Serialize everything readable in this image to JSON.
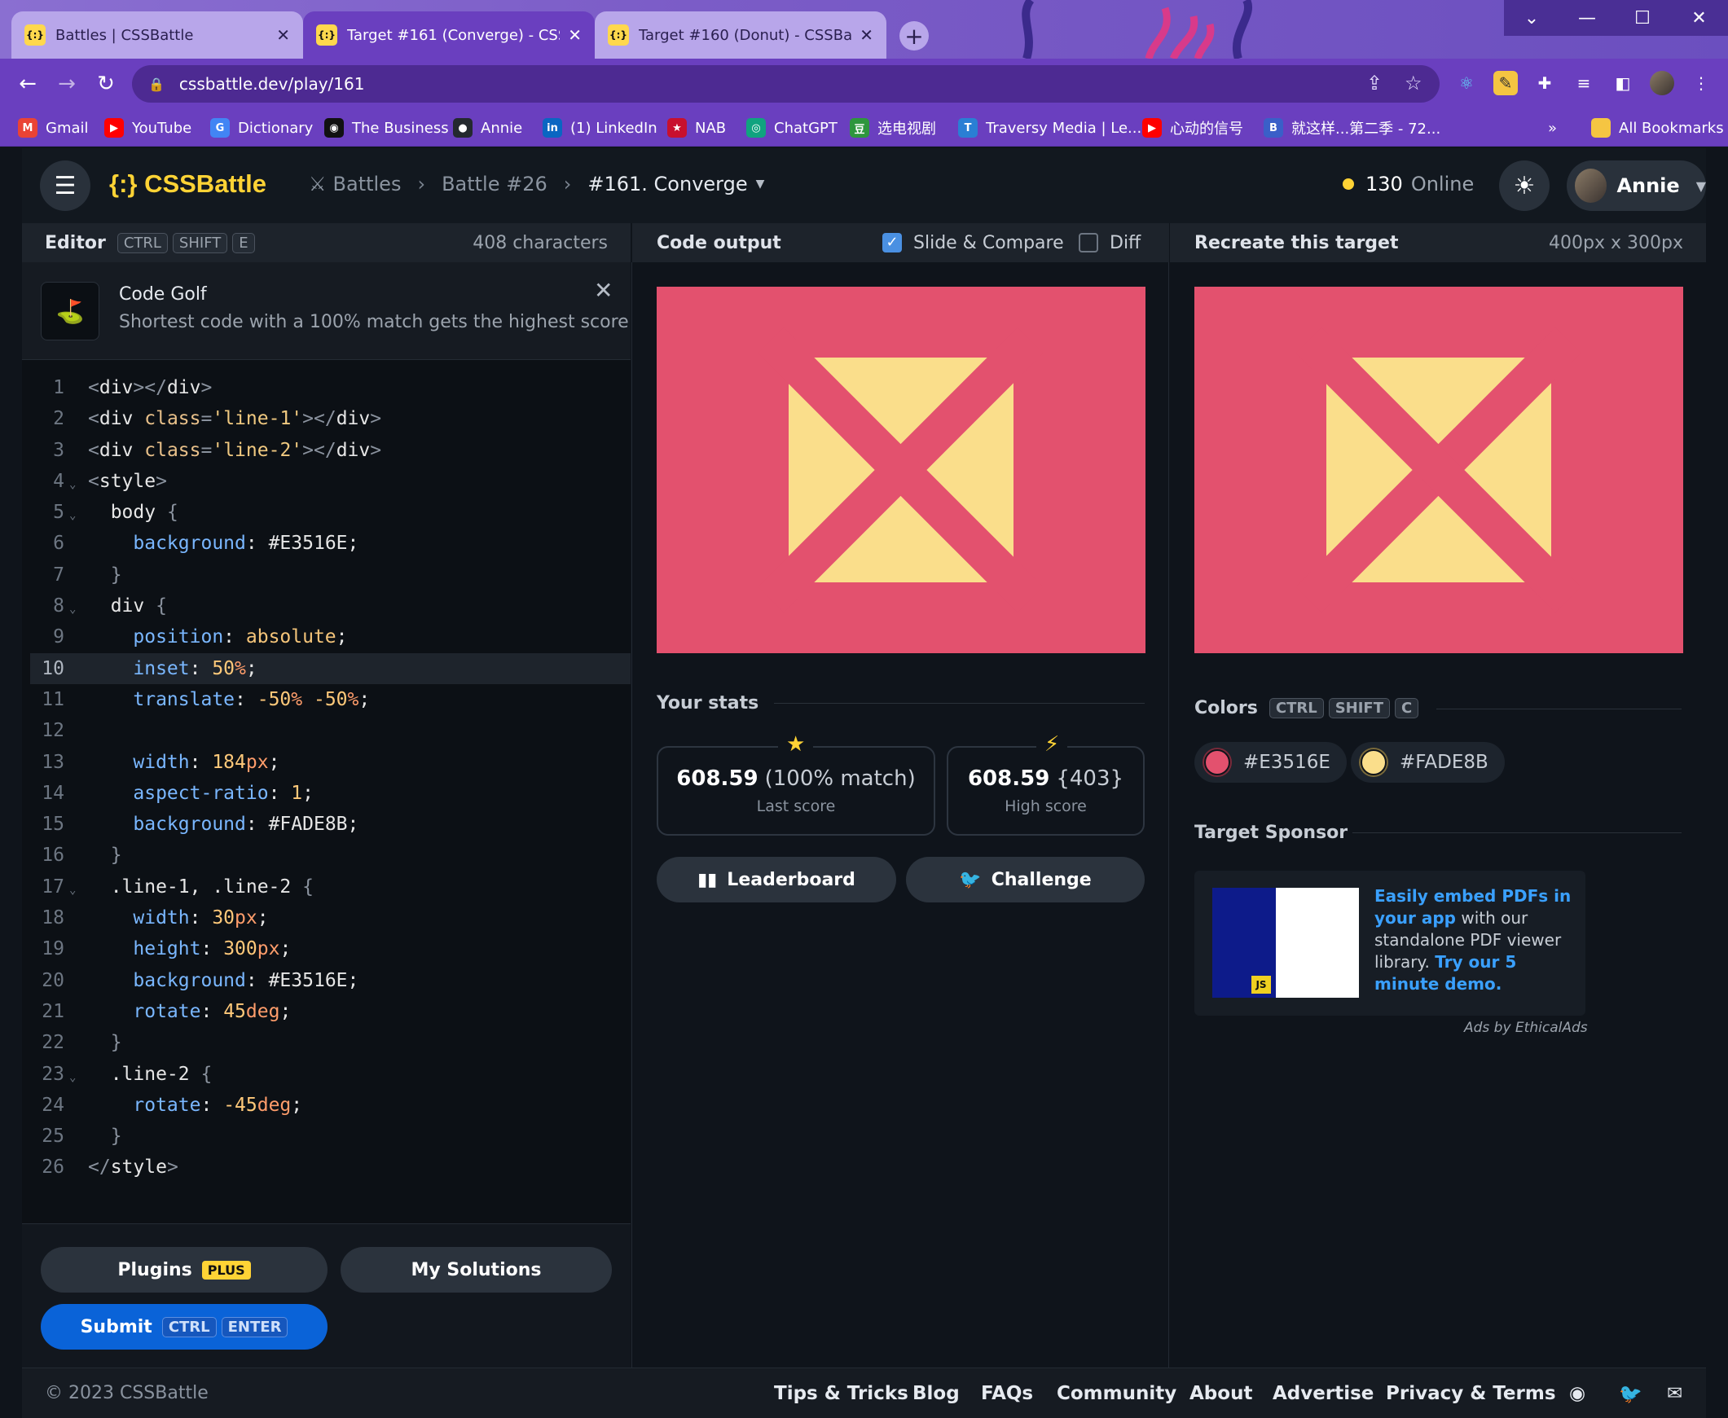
{
  "browser": {
    "tabs": [
      {
        "favicon": "{:}",
        "title": "Battles | CSSBattle",
        "close": "✕"
      },
      {
        "favicon": "{:}",
        "title": "Target #161 (Converge) - CSSBattle",
        "close": "✕"
      },
      {
        "favicon": "{:}",
        "title": "Target #160 (Donut) - CSSBattle",
        "close": "✕"
      }
    ],
    "url": "cssbattle.dev/play/161",
    "bookmarks": [
      {
        "label": "Gmail",
        "icon": "M",
        "color": "#ea4335"
      },
      {
        "label": "YouTube",
        "icon": "▶",
        "color": "#ff0000"
      },
      {
        "label": "Dictionary",
        "icon": "G",
        "color": "#4285f4"
      },
      {
        "label": "The Business",
        "icon": "◉",
        "color": "#111111"
      },
      {
        "label": "Annie",
        "icon": "●",
        "color": "#24292f"
      },
      {
        "label": "(1) LinkedIn",
        "icon": "in",
        "color": "#0a66c2"
      },
      {
        "label": "NAB",
        "icon": "★",
        "color": "#c8102e"
      },
      {
        "label": "ChatGPT",
        "icon": "◎",
        "color": "#10a37f"
      },
      {
        "label": "选电视剧",
        "icon": "豆",
        "color": "#2e963d"
      },
      {
        "label": "Traversy Media | Le...",
        "icon": "T",
        "color": "#2a7fd4"
      },
      {
        "label": "心动的信号",
        "icon": "▶",
        "color": "#ff0000"
      },
      {
        "label": "就这样...第二季 - 72...",
        "icon": "B",
        "color": "#3a5fc8"
      }
    ],
    "more_bookmarks": "»",
    "all_bookmarks": "All Bookmarks"
  },
  "header": {
    "logo": "{:} CSSBattle",
    "breadcrumb": [
      "Battles",
      "Battle #26",
      "#161. Converge"
    ],
    "online_count": "130",
    "online_label": "Online",
    "user": "Annie"
  },
  "editor": {
    "title": "Editor",
    "shortcut": [
      "CTRL",
      "SHIFT",
      "E"
    ],
    "char_count": "408 characters",
    "banner_title": "Code Golf",
    "banner_desc": "Shortest code with a 100% match gets the highest score",
    "highlight_line": 10,
    "lines": [
      [
        [
          "t-ang",
          "<"
        ],
        [
          "t-tag",
          "div"
        ],
        [
          "t-ang",
          "></"
        ],
        [
          "t-tag",
          "div"
        ],
        [
          "t-ang",
          ">"
        ]
      ],
      [
        [
          "t-ang",
          "<"
        ],
        [
          "t-tag",
          "div "
        ],
        [
          "t-attr",
          "class"
        ],
        [
          "t-ang",
          "="
        ],
        [
          "t-str",
          "'line-1'"
        ],
        [
          "t-ang",
          "></"
        ],
        [
          "t-tag",
          "div"
        ],
        [
          "t-ang",
          ">"
        ]
      ],
      [
        [
          "t-ang",
          "<"
        ],
        [
          "t-tag",
          "div "
        ],
        [
          "t-attr",
          "class"
        ],
        [
          "t-ang",
          "="
        ],
        [
          "t-str",
          "'line-2'"
        ],
        [
          "t-ang",
          "></"
        ],
        [
          "t-tag",
          "div"
        ],
        [
          "t-ang",
          ">"
        ]
      ],
      [
        [
          "t-ang",
          "<"
        ],
        [
          "t-tag",
          "style"
        ],
        [
          "t-ang",
          ">"
        ]
      ],
      [
        [
          "t-tag",
          "  body "
        ],
        [
          "t-brace",
          "{"
        ]
      ],
      [
        [
          "t-prop",
          "    background"
        ],
        [
          "t-tag",
          ": "
        ],
        [
          "t-tag",
          "#E3516E;"
        ]
      ],
      [
        [
          "t-brace",
          "  }"
        ]
      ],
      [
        [
          "t-tag",
          "  div "
        ],
        [
          "t-brace",
          "{"
        ]
      ],
      [
        [
          "t-prop",
          "    position"
        ],
        [
          "t-tag",
          ": "
        ],
        [
          "t-kw",
          "absolute"
        ],
        [
          "t-tag",
          ";"
        ]
      ],
      [
        [
          "t-prop",
          "    inset"
        ],
        [
          "t-tag",
          ": "
        ],
        [
          "t-num",
          "50"
        ],
        [
          "t-unit",
          "%"
        ],
        [
          "t-tag",
          ";"
        ]
      ],
      [
        [
          "t-prop",
          "    translate"
        ],
        [
          "t-tag",
          ": "
        ],
        [
          "t-num",
          "-50"
        ],
        [
          "t-unit",
          "% "
        ],
        [
          "t-num",
          "-50"
        ],
        [
          "t-unit",
          "%"
        ],
        [
          "t-tag",
          ";"
        ]
      ],
      [],
      [
        [
          "t-prop",
          "    width"
        ],
        [
          "t-tag",
          ": "
        ],
        [
          "t-num",
          "184"
        ],
        [
          "t-unit",
          "px"
        ],
        [
          "t-tag",
          ";"
        ]
      ],
      [
        [
          "t-prop",
          "    aspect-ratio"
        ],
        [
          "t-tag",
          ": "
        ],
        [
          "t-num",
          "1"
        ],
        [
          "t-tag",
          ";"
        ]
      ],
      [
        [
          "t-prop",
          "    background"
        ],
        [
          "t-tag",
          ": "
        ],
        [
          "t-tag",
          "#FADE8B;"
        ]
      ],
      [
        [
          "t-brace",
          "  }"
        ]
      ],
      [
        [
          "t-tag",
          "  .line-1, .line-2 "
        ],
        [
          "t-brace",
          "{"
        ]
      ],
      [
        [
          "t-prop",
          "    width"
        ],
        [
          "t-tag",
          ": "
        ],
        [
          "t-num",
          "30"
        ],
        [
          "t-unit",
          "px"
        ],
        [
          "t-tag",
          ";"
        ]
      ],
      [
        [
          "t-prop",
          "    height"
        ],
        [
          "t-tag",
          ": "
        ],
        [
          "t-num",
          "300"
        ],
        [
          "t-unit",
          "px"
        ],
        [
          "t-tag",
          ";"
        ]
      ],
      [
        [
          "t-prop",
          "    background"
        ],
        [
          "t-tag",
          ": "
        ],
        [
          "t-tag",
          "#E3516E;"
        ]
      ],
      [
        [
          "t-prop",
          "    rotate"
        ],
        [
          "t-tag",
          ": "
        ],
        [
          "t-num",
          "45"
        ],
        [
          "t-unit",
          "deg"
        ],
        [
          "t-tag",
          ";"
        ]
      ],
      [
        [
          "t-brace",
          "  }"
        ]
      ],
      [
        [
          "t-tag",
          "  .line-2 "
        ],
        [
          "t-brace",
          "{"
        ]
      ],
      [
        [
          "t-prop",
          "    rotate"
        ],
        [
          "t-tag",
          ": "
        ],
        [
          "t-num",
          "-45"
        ],
        [
          "t-unit",
          "deg"
        ],
        [
          "t-tag",
          ";"
        ]
      ],
      [
        [
          "t-brace",
          "  }"
        ]
      ],
      [
        [
          "t-ang",
          "</"
        ],
        [
          "t-tag",
          "style"
        ],
        [
          "t-ang",
          ">"
        ]
      ]
    ],
    "fold_lines": [
      4,
      5,
      8,
      17,
      23
    ],
    "plugins_label": "Plugins",
    "plugins_badge": "PLUS",
    "my_solutions_label": "My Solutions",
    "submit_label": "Submit",
    "submit_shortcut": [
      "CTRL",
      "ENTER"
    ]
  },
  "output": {
    "title": "Code output",
    "slide_compare_label": "Slide & Compare",
    "slide_compare_checked": true,
    "diff_label": "Diff",
    "diff_checked": false,
    "stats_title": "Your stats",
    "last_score": "608.59",
    "last_match": "(100% match)",
    "last_label": "Last score",
    "high_score": "608.59",
    "high_chars": "{403}",
    "high_label": "High score",
    "leaderboard_label": "Leaderboard",
    "challenge_label": "Challenge"
  },
  "target": {
    "title": "Recreate this target",
    "size": "400px x 300px",
    "colors_title": "Colors",
    "colors_shortcut": [
      "CTRL",
      "SHIFT",
      "C"
    ],
    "colors": [
      "#E3516E",
      "#FADE8B"
    ],
    "sponsor_title": "Target Sponsor",
    "ad_link1": "Easily embed PDFs in your app",
    "ad_text1": " with our standalone PDF viewer library. ",
    "ad_link2": "Try our 5 minute demo.",
    "ads_by": "Ads by EthicalAds"
  },
  "footer": {
    "copyright": "© 2023 CSSBattle",
    "links": [
      "Tips & Tricks",
      "Blog",
      "FAQs",
      "Community",
      "About",
      "Advertise",
      "Privacy & Terms"
    ]
  },
  "colors": {
    "accent": "#ffd335",
    "bg": "#0f141b",
    "pink": "#E3516E",
    "yellow": "#FADE8B",
    "blue": "#0a63d8"
  }
}
